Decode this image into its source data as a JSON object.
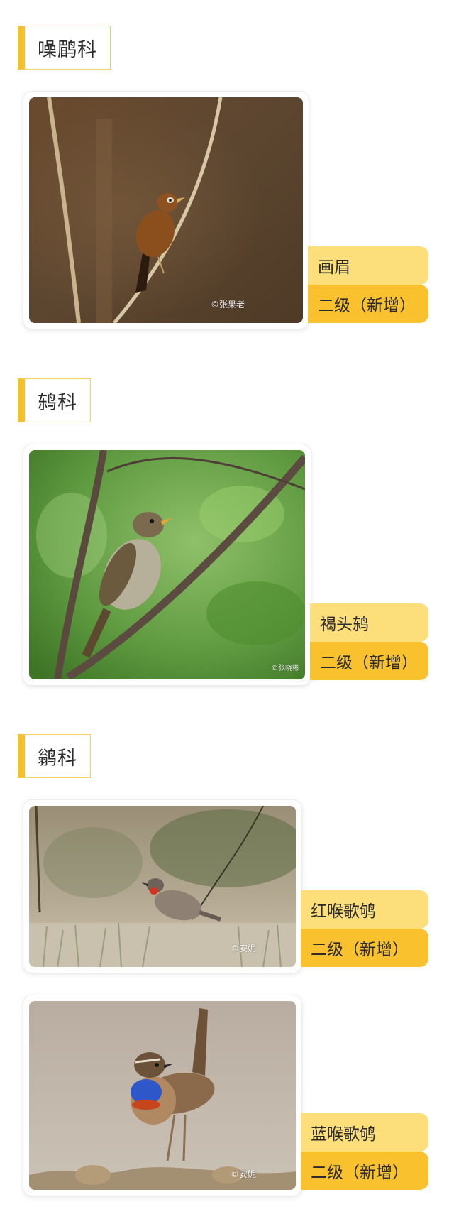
{
  "sections": [
    {
      "family": "噪鹛科",
      "birds": [
        {
          "name": "画眉",
          "level": "二级（新增）",
          "credit": "©张果老"
        }
      ]
    },
    {
      "family": "鸫科",
      "birds": [
        {
          "name": "褐头鸫",
          "level": "二级（新增）",
          "credit": "©张晓彬"
        }
      ]
    },
    {
      "family": "鹟科",
      "birds": [
        {
          "name": "红喉歌鸲",
          "level": "二级（新增）",
          "credit": "©安妮"
        },
        {
          "name": "蓝喉歌鸲",
          "level": "二级（新增）",
          "credit": "©安妮"
        }
      ]
    }
  ],
  "colors": {
    "accent": "#f5c02c",
    "tag_light": "#fcdf7a",
    "tag_dark": "#f9c12d"
  }
}
